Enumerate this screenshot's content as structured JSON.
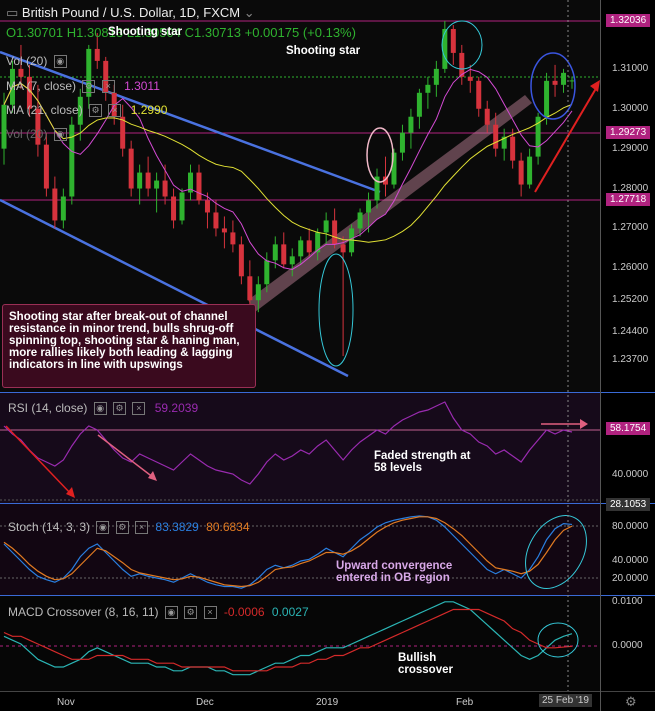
{
  "header": {
    "title": "British Pound / U.S. Dollar, 1D, FXCM",
    "ohlc": {
      "o": "O1.30701",
      "h": "H1.30813",
      "l": "L1.30504",
      "c": "C1.30713",
      "chg": "+0.00175 (+0.13%)"
    }
  },
  "overlay_labels": {
    "vol1": "Vol (20)",
    "ma7": "MA (7, close)",
    "ma7_value": "1.3011",
    "ma21": "MA (21, close)",
    "ma21_value": "1.2990",
    "vol2": "Vol (20)"
  },
  "annotations": {
    "shooting_star_top": "Shooting star",
    "shooting_star_right": "Shooting star",
    "callout": "Shooting star after break-out of channel resistance in minor trend, bulls shrug-off spinning top, shooting star & haning man, more rallies likely both leading & lagging indicators in line with upswings",
    "rsi_note": "Faded strength at 58 levels",
    "stoch_note": "Upward convergence entered in OB region",
    "macd_note": "Bullish crossover"
  },
  "price_axis": {
    "ticks": [
      "1.31000",
      "1.30000",
      "1.29000",
      "1.28000",
      "1.27000",
      "1.26000",
      "1.25200",
      "1.24400",
      "1.23700"
    ],
    "tags": [
      {
        "text": "1.32036",
        "color": "#b0227f"
      },
      {
        "text": "1.29273",
        "color": "#b0227f"
      },
      {
        "text": "1.27718",
        "color": "#b0227f"
      }
    ]
  },
  "rsi": {
    "label": "RSI (14, close)",
    "value": "59.2039",
    "axis_ticks": [
      "40.0000"
    ],
    "tags": [
      "58.1754",
      "28.1053"
    ]
  },
  "stoch": {
    "label": "Stoch (14, 3, 3)",
    "k": "83.3829",
    "d": "80.6834",
    "axis_ticks": [
      "80.0000",
      "40.0000",
      "20.0000"
    ]
  },
  "macd": {
    "label": "MACD Crossover (8, 16, 11)",
    "v1": "-0.0006",
    "v2": "0.0027",
    "axis_ticks": [
      "0.0100",
      "0.0000"
    ]
  },
  "time_axis": {
    "labels": [
      "Nov",
      "Dec",
      "2019",
      "Feb"
    ],
    "current": "25 Feb '19"
  },
  "colors": {
    "up": "#2fb32f",
    "down": "#d6333d",
    "ma7": "#d34ad3",
    "ma21": "#e0e034",
    "channel": "#4a72e0",
    "rsi": "#9a2bb0",
    "stoch_k": "#2a7fe0",
    "stoch_d": "#e07a22",
    "macd_main": "#2bb5b5",
    "macd_signal": "#d42a2a"
  },
  "chart_data": [
    {
      "type": "candlestick",
      "title": "British Pound / U.S. Dollar, 1D, FXCM",
      "ylim": [
        1.232,
        1.322
      ],
      "x_labels": [
        "Nov",
        "Dec",
        "2019",
        "Feb"
      ],
      "ohlc": [
        [
          1.29,
          1.304,
          1.286,
          1.301
        ],
        [
          1.301,
          1.312,
          1.299,
          1.31
        ],
        [
          1.31,
          1.316,
          1.305,
          1.308
        ],
        [
          1.308,
          1.311,
          1.298,
          1.3
        ],
        [
          1.3,
          1.306,
          1.288,
          1.291
        ],
        [
          1.291,
          1.294,
          1.278,
          1.28
        ],
        [
          1.28,
          1.283,
          1.27,
          1.272
        ],
        [
          1.272,
          1.28,
          1.27,
          1.278
        ],
        [
          1.278,
          1.298,
          1.276,
          1.296
        ],
        [
          1.296,
          1.305,
          1.292,
          1.303
        ],
        [
          1.303,
          1.316,
          1.3,
          1.315
        ],
        [
          1.315,
          1.319,
          1.31,
          1.312
        ],
        [
          1.312,
          1.313,
          1.302,
          1.304
        ],
        [
          1.304,
          1.306,
          1.296,
          1.298
        ],
        [
          1.298,
          1.301,
          1.288,
          1.29
        ],
        [
          1.29,
          1.292,
          1.278,
          1.28
        ],
        [
          1.28,
          1.286,
          1.276,
          1.284
        ],
        [
          1.284,
          1.288,
          1.278,
          1.28
        ],
        [
          1.28,
          1.284,
          1.274,
          1.282
        ],
        [
          1.282,
          1.286,
          1.276,
          1.278
        ],
        [
          1.278,
          1.28,
          1.27,
          1.272
        ],
        [
          1.272,
          1.28,
          1.271,
          1.279
        ],
        [
          1.279,
          1.286,
          1.277,
          1.284
        ],
        [
          1.284,
          1.286,
          1.276,
          1.277
        ],
        [
          1.277,
          1.279,
          1.27,
          1.274
        ],
        [
          1.274,
          1.277,
          1.268,
          1.27
        ],
        [
          1.27,
          1.273,
          1.265,
          1.269
        ],
        [
          1.269,
          1.272,
          1.264,
          1.266
        ],
        [
          1.266,
          1.268,
          1.256,
          1.258
        ],
        [
          1.258,
          1.262,
          1.248,
          1.252
        ],
        [
          1.252,
          1.258,
          1.249,
          1.256
        ],
        [
          1.256,
          1.264,
          1.254,
          1.262
        ],
        [
          1.262,
          1.268,
          1.26,
          1.266
        ],
        [
          1.266,
          1.269,
          1.26,
          1.261
        ],
        [
          1.261,
          1.265,
          1.258,
          1.263
        ],
        [
          1.263,
          1.268,
          1.261,
          1.267
        ],
        [
          1.267,
          1.27,
          1.263,
          1.264
        ],
        [
          1.264,
          1.27,
          1.262,
          1.269
        ],
        [
          1.269,
          1.274,
          1.266,
          1.272
        ],
        [
          1.272,
          1.275,
          1.265,
          1.266
        ],
        [
          1.266,
          1.268,
          1.238,
          1.264
        ],
        [
          1.264,
          1.271,
          1.263,
          1.27
        ],
        [
          1.27,
          1.275,
          1.268,
          1.274
        ],
        [
          1.274,
          1.279,
          1.269,
          1.277
        ],
        [
          1.277,
          1.285,
          1.275,
          1.283
        ],
        [
          1.283,
          1.288,
          1.278,
          1.281
        ],
        [
          1.281,
          1.29,
          1.28,
          1.289
        ],
        [
          1.289,
          1.296,
          1.287,
          1.294
        ],
        [
          1.294,
          1.3,
          1.29,
          1.298
        ],
        [
          1.298,
          1.305,
          1.295,
          1.304
        ],
        [
          1.304,
          1.308,
          1.3,
          1.306
        ],
        [
          1.306,
          1.312,
          1.303,
          1.31
        ],
        [
          1.31,
          1.322,
          1.309,
          1.32
        ],
        [
          1.32,
          1.321,
          1.311,
          1.314
        ],
        [
          1.314,
          1.316,
          1.306,
          1.308
        ],
        [
          1.308,
          1.311,
          1.304,
          1.307
        ],
        [
          1.307,
          1.308,
          1.298,
          1.3
        ],
        [
          1.3,
          1.302,
          1.294,
          1.296
        ],
        [
          1.296,
          1.299,
          1.288,
          1.29
        ],
        [
          1.29,
          1.295,
          1.287,
          1.293
        ],
        [
          1.293,
          1.295,
          1.285,
          1.287
        ],
        [
          1.287,
          1.289,
          1.278,
          1.281
        ],
        [
          1.281,
          1.29,
          1.28,
          1.288
        ],
        [
          1.288,
          1.299,
          1.286,
          1.298
        ],
        [
          1.298,
          1.309,
          1.296,
          1.307
        ],
        [
          1.307,
          1.311,
          1.303,
          1.306
        ],
        [
          1.306,
          1.31,
          1.304,
          1.309
        ],
        [
          1.307,
          1.3081,
          1.305,
          1.3071
        ]
      ]
    },
    {
      "type": "line",
      "title": "RSI (14, close)",
      "ylim": [
        25,
        75
      ],
      "values": [
        62,
        58,
        55,
        50,
        46,
        44,
        42,
        45,
        52,
        58,
        62,
        60,
        55,
        50,
        46,
        44,
        48,
        46,
        44,
        42,
        40,
        44,
        48,
        45,
        42,
        40,
        39,
        38,
        35,
        33,
        38,
        44,
        48,
        45,
        47,
        50,
        48,
        52,
        55,
        50,
        45,
        50,
        54,
        57,
        60,
        58,
        62,
        65,
        67,
        69,
        70,
        72,
        74,
        66,
        60,
        58,
        54,
        52,
        48,
        50,
        47,
        44,
        50,
        55,
        60,
        58,
        60,
        59
      ]
    },
    {
      "type": "line",
      "title": "Stoch (14, 3, 3)",
      "ylim": [
        0,
        100
      ],
      "series": [
        {
          "name": "%K",
          "values": [
            60,
            50,
            40,
            30,
            22,
            18,
            15,
            20,
            30,
            45,
            55,
            60,
            50,
            40,
            30,
            22,
            25,
            22,
            20,
            18,
            15,
            20,
            25,
            20,
            15,
            12,
            10,
            10,
            8,
            12,
            20,
            30,
            35,
            32,
            35,
            40,
            42,
            48,
            55,
            50,
            45,
            55,
            65,
            72,
            80,
            85,
            88,
            90,
            92,
            93,
            92,
            88,
            80,
            70,
            60,
            50,
            40,
            30,
            25,
            30,
            25,
            20,
            30,
            45,
            65,
            78,
            84,
            83
          ]
        },
        {
          "name": "%D",
          "values": [
            62,
            55,
            46,
            36,
            28,
            22,
            18,
            19,
            25,
            35,
            45,
            55,
            52,
            45,
            38,
            30,
            26,
            24,
            22,
            20,
            18,
            19,
            22,
            21,
            18,
            15,
            12,
            11,
            10,
            11,
            15,
            22,
            30,
            32,
            33,
            37,
            40,
            45,
            50,
            50,
            48,
            52,
            58,
            66,
            74,
            80,
            85,
            88,
            90,
            92,
            92,
            90,
            85,
            78,
            70,
            60,
            50,
            40,
            32,
            30,
            28,
            25,
            28,
            36,
            50,
            65,
            76,
            81
          ]
        }
      ]
    },
    {
      "type": "line",
      "title": "MACD Crossover (8, 16, 11)",
      "ylim": [
        -0.012,
        0.012
      ],
      "series": [
        {
          "name": "MACD",
          "values": [
            0.002,
            0.001,
            0.0,
            -0.002,
            -0.004,
            -0.005,
            -0.006,
            -0.006,
            -0.005,
            -0.004,
            -0.002,
            -0.001,
            -0.002,
            -0.003,
            -0.004,
            -0.005,
            -0.005,
            -0.005,
            -0.006,
            -0.006,
            -0.007,
            -0.007,
            -0.006,
            -0.006,
            -0.006,
            -0.007,
            -0.007,
            -0.008,
            -0.008,
            -0.008,
            -0.007,
            -0.006,
            -0.005,
            -0.005,
            -0.004,
            -0.003,
            -0.003,
            -0.002,
            -0.001,
            -0.001,
            -0.001,
            0.0,
            0.001,
            0.002,
            0.003,
            0.004,
            0.005,
            0.006,
            0.007,
            0.008,
            0.009,
            0.01,
            0.011,
            0.011,
            0.01,
            0.009,
            0.007,
            0.005,
            0.003,
            0.001,
            -0.001,
            -0.003,
            -0.004,
            -0.003,
            -0.001,
            0.001,
            0.002,
            0.0027
          ]
        },
        {
          "name": "Signal",
          "values": [
            0.003,
            0.002,
            0.002,
            0.001,
            0.0,
            -0.001,
            -0.002,
            -0.003,
            -0.004,
            -0.004,
            -0.004,
            -0.003,
            -0.003,
            -0.003,
            -0.003,
            -0.004,
            -0.004,
            -0.004,
            -0.005,
            -0.005,
            -0.005,
            -0.006,
            -0.006,
            -0.006,
            -0.006,
            -0.006,
            -0.006,
            -0.007,
            -0.007,
            -0.007,
            -0.007,
            -0.007,
            -0.006,
            -0.006,
            -0.006,
            -0.005,
            -0.005,
            -0.004,
            -0.004,
            -0.003,
            -0.003,
            -0.002,
            -0.001,
            -0.001,
            0.0,
            0.001,
            0.002,
            0.003,
            0.004,
            0.005,
            0.006,
            0.007,
            0.008,
            0.009,
            0.009,
            0.009,
            0.009,
            0.008,
            0.007,
            0.006,
            0.004,
            0.003,
            0.001,
            0.0,
            -0.001,
            -0.001,
            -0.0008,
            -0.0006
          ]
        }
      ]
    }
  ]
}
